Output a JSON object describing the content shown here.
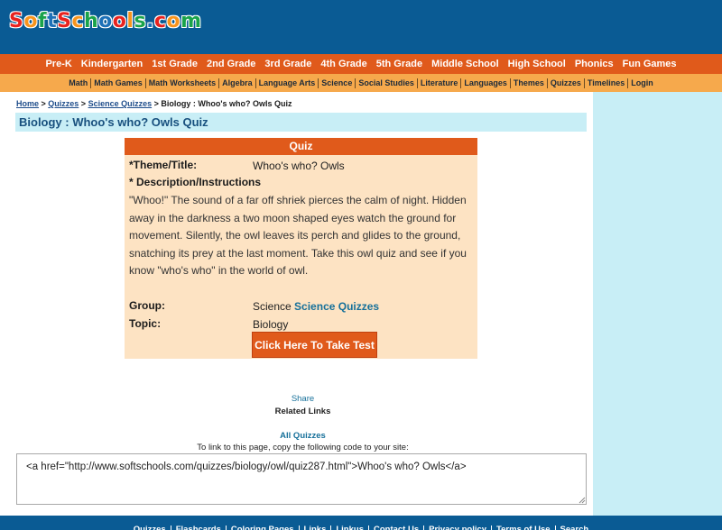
{
  "logo": {
    "letters": [
      "S",
      "o",
      "f",
      "t",
      "S",
      "c",
      "h",
      "o",
      "o",
      "l",
      "s",
      ".",
      "c",
      "o",
      "m"
    ],
    "colors": [
      "#e8231f",
      "#f7941d",
      "#1aa34a",
      "#1d71b8",
      "#e8231f",
      "#f7941d",
      "#1aa34a",
      "#1d71b8",
      "#e8231f",
      "#f7941d",
      "#1aa34a",
      "#1d71b8",
      "#e8231f",
      "#f7941d",
      "#1aa34a"
    ]
  },
  "topnav": [
    "Pre-K",
    "Kindergarten",
    "1st Grade",
    "2nd Grade",
    "3rd Grade",
    "4th Grade",
    "5th Grade",
    "Middle School",
    "High School",
    "Phonics",
    "Fun Games"
  ],
  "subnav": [
    "Math",
    "Math Games",
    "Math Worksheets",
    "Algebra",
    "Language Arts",
    "Science",
    "Social Studies",
    "Literature",
    "Languages",
    "Themes",
    "Quizzes",
    "Timelines",
    "Login"
  ],
  "breadcrumb": {
    "home": "Home",
    "sep1": " > ",
    "quizzes": "Quizzes",
    "sep2": " > ",
    "science": "Science Quizzes",
    "rest": " > Biology : Whoo's who? Owls Quiz"
  },
  "page_title": "Biology : Whoo's who? Owls Quiz",
  "quiz": {
    "header": "Quiz",
    "theme_label": "*Theme/Title:",
    "theme_value": "Whoo's who? Owls",
    "desc_label": "* Description/Instructions",
    "description": "\"Whoo!\" The sound of a far off shriek pierces the calm of night. Hidden away in the darkness a two moon shaped eyes watch the ground for movement. Silently, the owl leaves its perch and glides to the ground, snatching its prey at the last moment. Take this owl quiz and see if you know \"who's who\" in the world of owl.",
    "group_label": "Group:",
    "group_value": "Science",
    "group_link": "Science Quizzes",
    "topic_label": "Topic:",
    "topic_value": "Biology",
    "button": "Click Here To Take Test"
  },
  "share": "Share",
  "related_links": "Related Links",
  "all_quizzes": "All Quizzes",
  "link_info": "To link to this page, copy the following code to your site:",
  "link_code": "<a href=\"http://www.softschools.com/quizzes/biology/owl/quiz287.html\">Whoo's who? Owls</a>",
  "footer": [
    "Quizzes",
    "Flashcards",
    "Coloring Pages",
    "Links",
    "Linkus",
    "Contact Us",
    "Privacy policy",
    "Terms of Use",
    "Search"
  ],
  "colors": {
    "header_blue": "#0a5b94",
    "nav_orange": "#e05a1b",
    "subnav_orange": "#f6a94c",
    "light_blue": "#c8eef6",
    "quiz_bg": "#fde3c3"
  }
}
